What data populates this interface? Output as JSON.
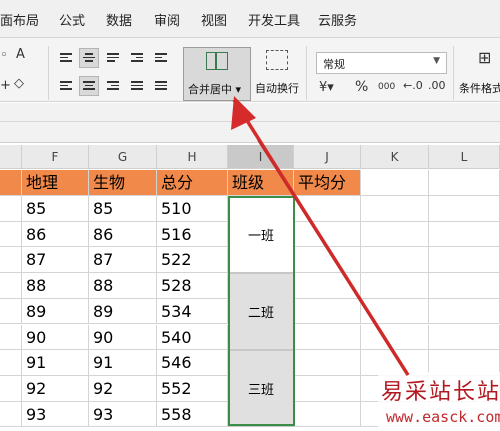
{
  "menu": {
    "items": [
      "面布局",
      "公式",
      "数据",
      "审阅",
      "视图",
      "开发工具",
      "云服务"
    ]
  },
  "ribbon": {
    "merge_center_label": "合并居中",
    "auto_wrap_label": "自动换行",
    "number_format_value": "常规",
    "conditional_format_label": "条件格式",
    "percent_symbol": "%",
    "thousands_symbol": "000",
    "font_a_glyph": "A"
  },
  "columns": [
    "F",
    "G",
    "H",
    "I",
    "J",
    "K",
    "L"
  ],
  "table": {
    "headers": [
      "地理",
      "生物",
      "总分",
      "班级",
      "平均分"
    ],
    "rows": [
      [
        "85",
        "85",
        "510"
      ],
      [
        "86",
        "86",
        "516"
      ],
      [
        "87",
        "87",
        "522"
      ],
      [
        "88",
        "88",
        "528"
      ],
      [
        "89",
        "89",
        "534"
      ],
      [
        "90",
        "90",
        "540"
      ],
      [
        "91",
        "91",
        "546"
      ],
      [
        "92",
        "92",
        "552"
      ],
      [
        "93",
        "93",
        "558"
      ]
    ],
    "classes": [
      "一班",
      "二班",
      "三班"
    ]
  },
  "watermark": {
    "site_name": "易采站长站",
    "url": "www.easck.com"
  },
  "colors": {
    "header_fill": "#f0894a",
    "selection_green": "#3c8d49",
    "arrow_red": "#d62b2b"
  }
}
